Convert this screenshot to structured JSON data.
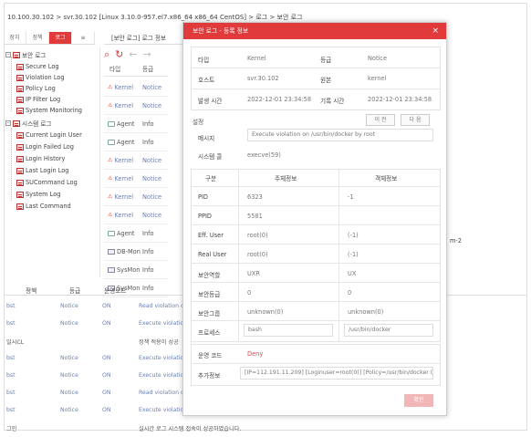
{
  "breadcrumb": "10.100.30.102 > svr.30.102 [Linux 3.10.0-957.el7.x86_64 x86_64 CentOS] > 로그 > 보안 로그",
  "left_tabs": [
    "장치",
    "정책",
    "로그",
    "≡"
  ],
  "tree": {
    "security_root": "보안 로그",
    "security_items": [
      "Secure Log",
      "Violation Log",
      "Policy Log",
      "IP Filter Log",
      "System Monitoring"
    ],
    "system_root": "시스템 로그",
    "system_items": [
      "Current Login User",
      "Login Failed Log",
      "Login History",
      "Last Login Log",
      "SUCommand Log",
      "System Log",
      "Last Command"
    ]
  },
  "mid_tab": "[보안 로그] 로그 정보",
  "list_header": {
    "type": "타입",
    "grade": "등급"
  },
  "list_rows": [
    {
      "type": "Kernel",
      "grade": "Notice",
      "icon": "kernel"
    },
    {
      "type": "Kernel",
      "grade": "Notice",
      "icon": "kernel"
    },
    {
      "type": "Agent",
      "grade": "Info",
      "icon": "agent"
    },
    {
      "type": "Agent",
      "grade": "Info",
      "icon": "agent"
    },
    {
      "type": "Kernel",
      "grade": "Notice",
      "icon": "kernel"
    },
    {
      "type": "Kernel",
      "grade": "Notice",
      "icon": "kernel"
    },
    {
      "type": "Kernel",
      "grade": "Notice",
      "icon": "kernel"
    },
    {
      "type": "Kernel",
      "grade": "Notice",
      "icon": "kernel"
    },
    {
      "type": "Agent",
      "grade": "Info",
      "icon": "agent"
    },
    {
      "type": "DB-Mon",
      "grade": "Info",
      "icon": "db"
    },
    {
      "type": "SysMon",
      "grade": "Info",
      "icon": "db"
    },
    {
      "type": "SysMon",
      "grade": "Info",
      "icon": "db"
    }
  ],
  "right_text": "m-2",
  "bottom": {
    "headers": {
      "policy": "정책",
      "grade": "등급",
      "mode": "운영모드"
    },
    "rows": [
      {
        "c0": "bst",
        "grade": "Notice",
        "mode": "ON",
        "msg": "Read violation c"
      },
      {
        "c0": "bst",
        "grade": "Notice",
        "mode": "ON",
        "msg": "Execute violatio"
      },
      {
        "c0": "일시CL",
        "grade": "",
        "mode": "",
        "msg": "정책 적용이 성공"
      },
      {
        "c0": "bst",
        "grade": "Notice",
        "mode": "ON",
        "msg": "Execute violatio"
      },
      {
        "c0": "bst",
        "grade": "Notice",
        "mode": "ON",
        "msg": "Execute violatio"
      },
      {
        "c0": "bst",
        "grade": "Notice",
        "mode": "ON",
        "msg": "Read violation c"
      },
      {
        "c0": "bst",
        "grade": "Notice",
        "mode": "ON",
        "msg": "Execute violatio"
      },
      {
        "c0": "그인",
        "grade": "",
        "mode": "",
        "msg": "실시간 로그 시스템 접속이 성공하였습니다."
      }
    ]
  },
  "modal": {
    "title": "보안 로그 - 등록 정보",
    "close": "×",
    "type_label": "타입",
    "type_value": "Kernel",
    "grade_label": "등급",
    "grade_value": "Notice",
    "host_label": "호스트",
    "host_value": "svr.30.102",
    "source_label": "원본",
    "source_value": "kernel",
    "occur_label": "발생 시간",
    "occur_value": "2022-12-01 23:34:58",
    "record_label": "기록 시간",
    "record_value": "2022-12-01 23:34:58",
    "section_label": "설정",
    "prev": "이 전",
    "next": "다 음",
    "message_label": "메시지",
    "message_value": "Execute violation on /usr/bin/docker by root",
    "syscall_label": "시스템 콜",
    "syscall_value": "execve(59)",
    "sub_headers": [
      "구분",
      "주체정보",
      "객체정보"
    ],
    "sub_rows": [
      {
        "label": "PID",
        "subject": "6323",
        "object": "-1"
      },
      {
        "label": "PPID",
        "subject": "5581",
        "object": ""
      },
      {
        "label": "Eff. User",
        "subject": "root(0)",
        "object": "(-1)"
      },
      {
        "label": "Real User",
        "subject": "root(0)",
        "object": "(-1)"
      },
      {
        "label": "보안역할",
        "subject": "UXR",
        "object": "UX"
      },
      {
        "label": "보안등급",
        "subject": "0",
        "object": "0"
      },
      {
        "label": "보안그룹",
        "subject": "unknown(0)",
        "object": "unknown(0)"
      }
    ],
    "process_label": "프로세스",
    "process_subject": "bash",
    "process_object": "/usr/bin/docker",
    "opcode_label": "운영 코드",
    "opcode_value": "Deny",
    "extra_label": "추가정보",
    "extra_value": "[IP=112.191.11.209] [Loginuser=root(0)] [Policy=/usr/bin/docker (besal]",
    "ok": "확인"
  }
}
